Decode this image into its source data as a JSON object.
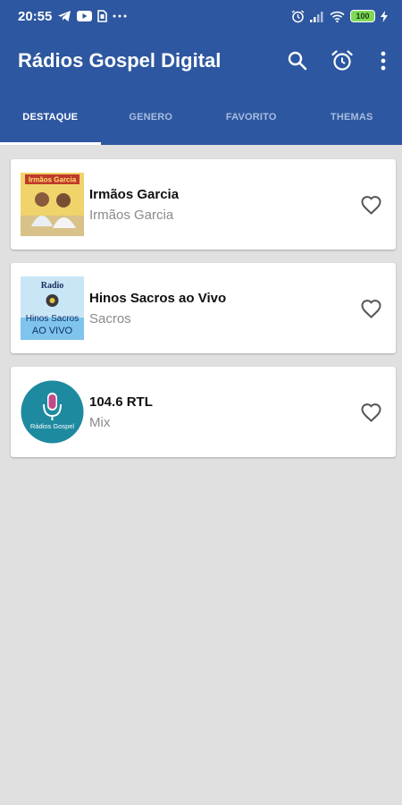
{
  "status_bar": {
    "time": "20:55",
    "left_icons": [
      "telegram-icon",
      "youtube-icon",
      "sim-icon",
      "more-dots-icon"
    ],
    "right_icons": [
      "alarm-icon",
      "signal-icon",
      "wifi-icon"
    ],
    "battery": "100"
  },
  "app_bar": {
    "title": "Rádios Gospel Digital",
    "actions": [
      "search-icon",
      "alarm-clock-icon",
      "more-vert-icon"
    ]
  },
  "tabs": [
    {
      "label": "DESTAQUE",
      "active": true
    },
    {
      "label": "GENERO",
      "active": false
    },
    {
      "label": "FAVORITO",
      "active": false
    },
    {
      "label": "THEMAS",
      "active": false
    }
  ],
  "stations": [
    {
      "title": "Irmãos Garcia",
      "subtitle": "Irmãos Garcia",
      "thumb_text": "Irmãos Garcia"
    },
    {
      "title": "Hinos Sacros ao Vivo",
      "subtitle": "Sacros",
      "thumb_text": [
        "Radio",
        "Hinos Sacros",
        "AO VIVO"
      ]
    },
    {
      "title": "104.6 RTL",
      "subtitle": "Mix",
      "thumb_text": "Rádios Gospel"
    }
  ],
  "colors": {
    "primary": "#2d57a0",
    "background": "#e0e0e0",
    "card": "#ffffff",
    "tab_inactive": "#a8bde0",
    "battery": "#7ed957",
    "rtl_badge": "#1e8aa0"
  }
}
